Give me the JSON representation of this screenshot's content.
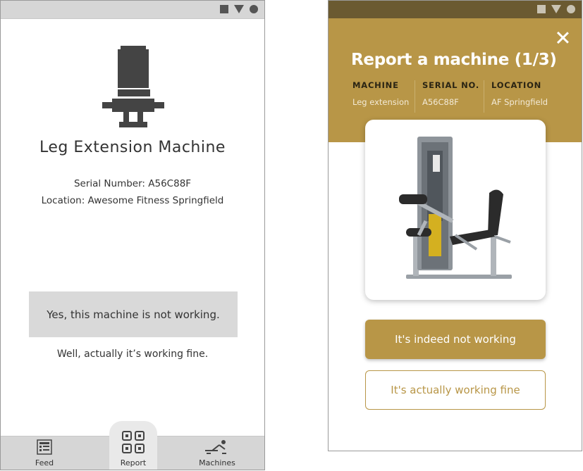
{
  "wireframe": {
    "machine_name": "Leg Extension Machine",
    "serial_line": "Serial Number: A56C88F",
    "location_line": "Location: Awesome Fitness Springfield",
    "yes_button": "Yes, this machine is not working.",
    "fine_link": "Well, actually it’s working fine.",
    "nav": {
      "feed": "Feed",
      "report": "Report",
      "machines": "Machines"
    }
  },
  "design": {
    "title": "Report a machine (1/3)",
    "info": {
      "machine_label": "MACHINE",
      "machine_value": "Leg extension",
      "serial_label": "SERIAL NO.",
      "serial_value": "A56C88F",
      "location_label": "LOCATION",
      "location_value": "AF Springfield"
    },
    "primary_button": "It's indeed not working",
    "secondary_button": "It's actually working fine"
  },
  "colors": {
    "gold": "#b89647",
    "gold_dark": "#6b5a31",
    "wireframe_gray": "#d6d6d6"
  },
  "icons": [
    "square-icon",
    "triangle-icon",
    "circle-icon",
    "chair-icon",
    "feed-icon",
    "qr-code-icon",
    "machines-icon",
    "close-icon"
  ]
}
